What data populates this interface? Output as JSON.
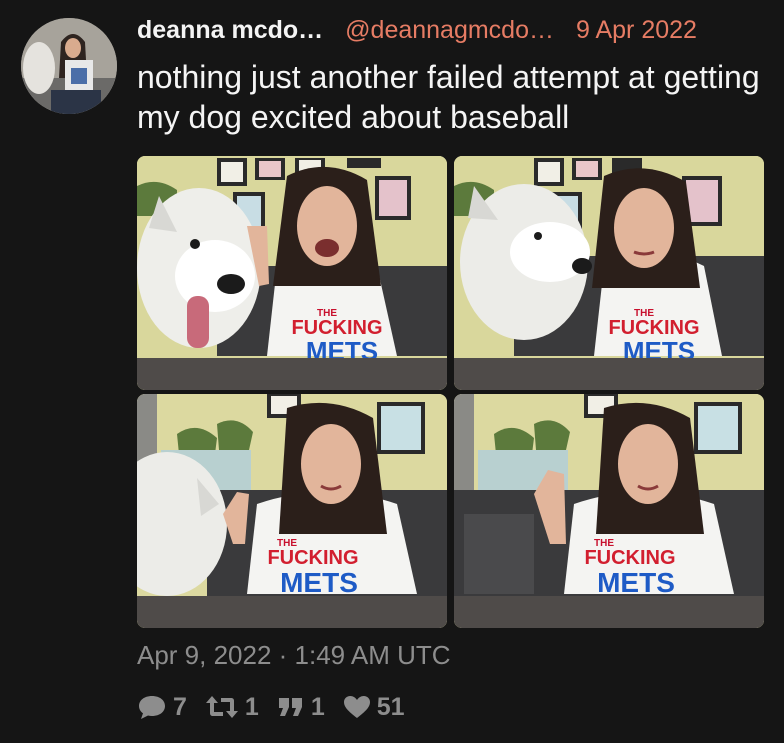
{
  "tweet": {
    "display_name": "deanna mcdo…",
    "username": "@deannagmcdo…",
    "date": "9 Apr 2022",
    "text": "nothing just another failed attempt at getting my dog excited about baseball",
    "timestamp": "Apr 9, 2022 · 1:49 AM UTC",
    "photos": [
      {
        "shirt_top": "THE",
        "shirt_mid": "FUCKING",
        "shirt_bottom": "METS"
      },
      {
        "shirt_top": "THE",
        "shirt_mid": "FUCKING",
        "shirt_bottom": "METS"
      },
      {
        "shirt_top": "THE",
        "shirt_mid": "FUCKING",
        "shirt_bottom": "METS"
      },
      {
        "shirt_top": "THE",
        "shirt_mid": "FUCKING",
        "shirt_bottom": "METS"
      }
    ],
    "stats": {
      "replies": "7",
      "retweets": "1",
      "quotes": "1",
      "likes": "51"
    }
  },
  "icons": {
    "reply": "speech-bubble-icon",
    "retweet": "retweet-arrows-icon",
    "quote": "quote-marks-icon",
    "like": "heart-icon"
  },
  "colors": {
    "background": "#151515",
    "accent": "#e67c64",
    "muted": "#8d8d8d"
  }
}
